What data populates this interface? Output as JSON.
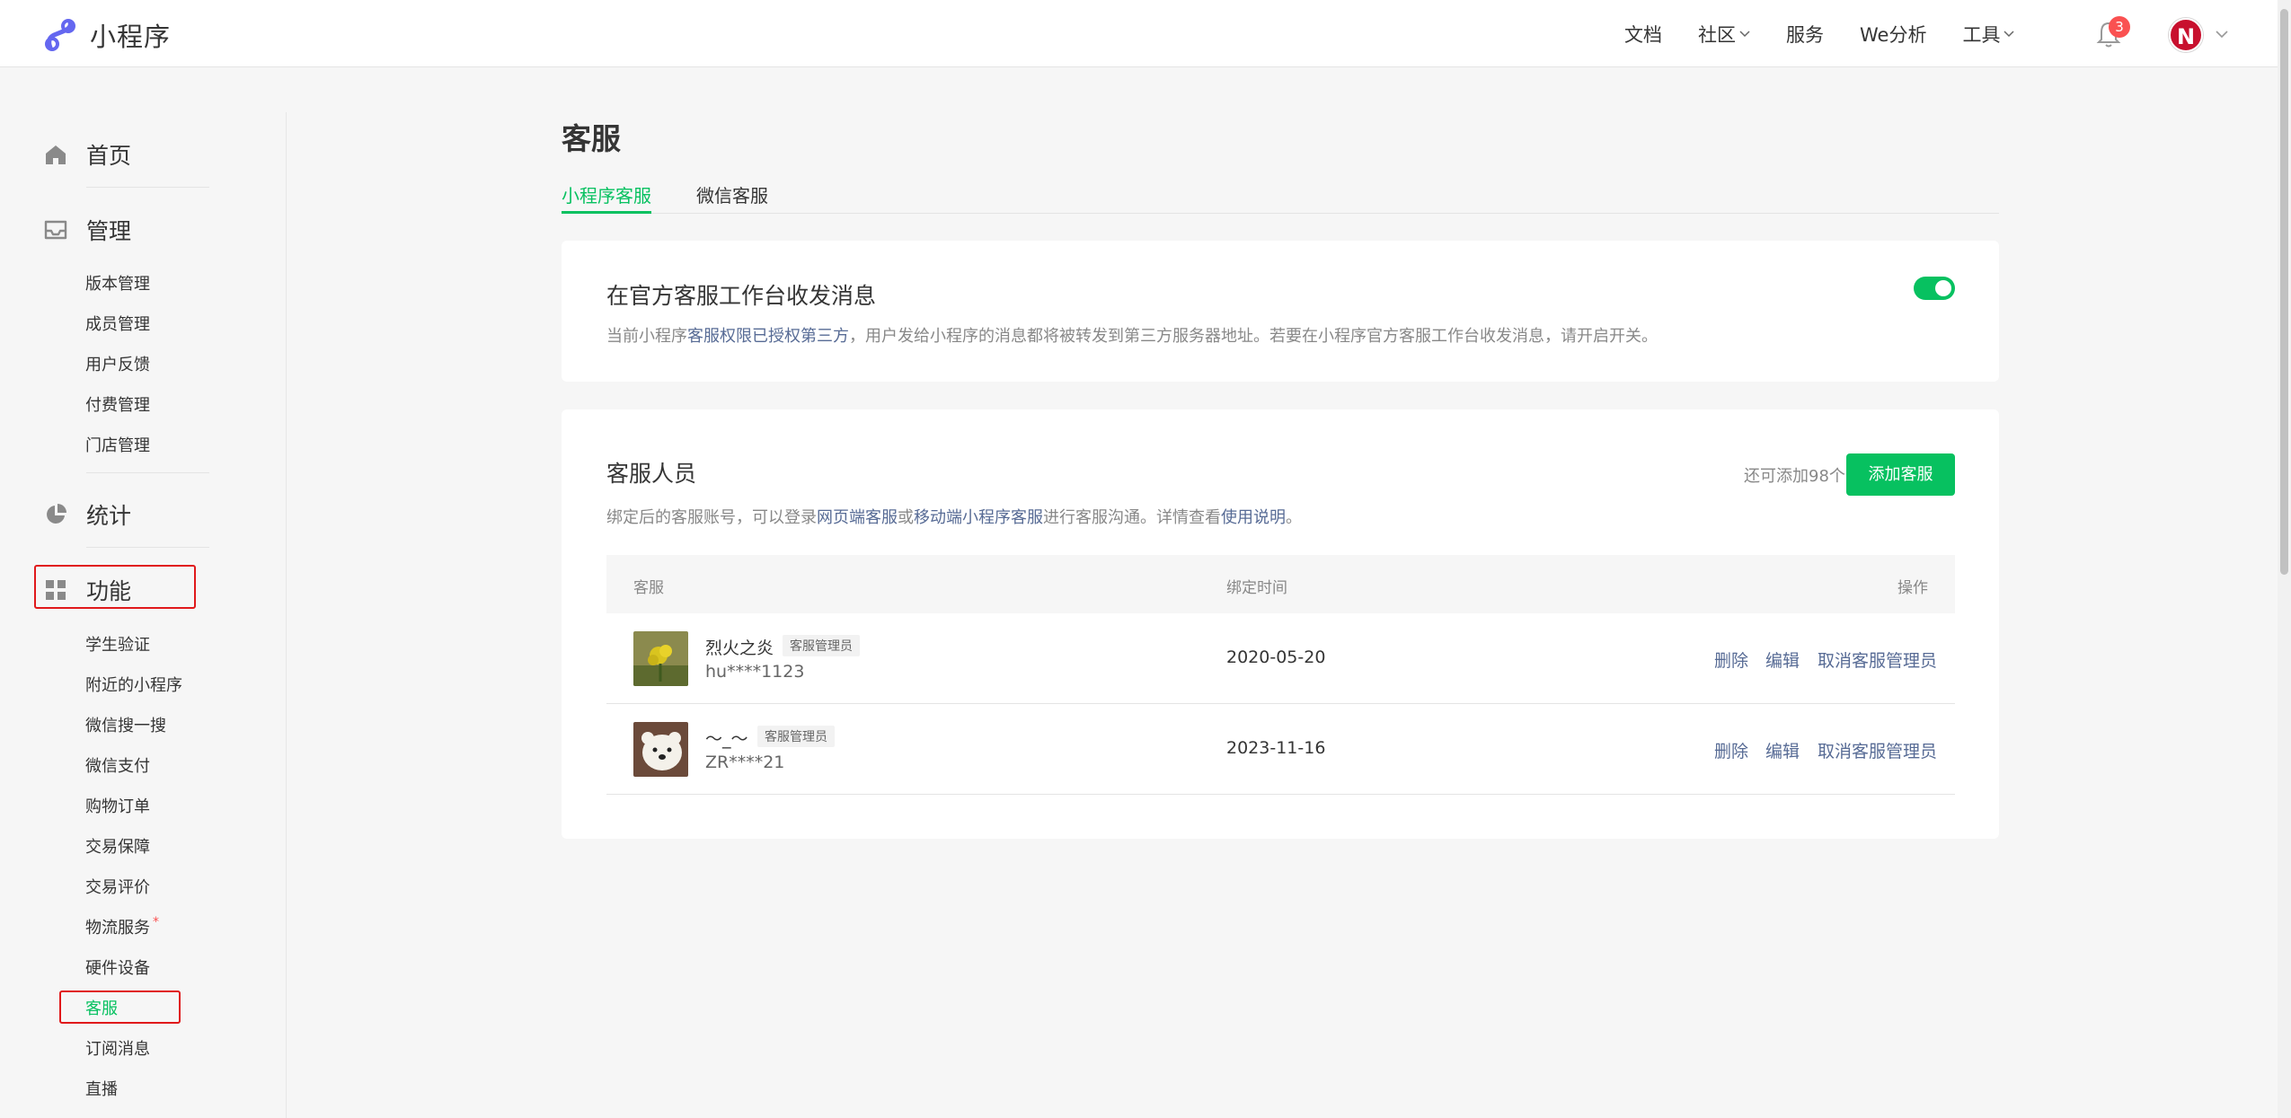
{
  "header": {
    "brand": "小程序",
    "nav": [
      {
        "label": "文档",
        "dropdown": false
      },
      {
        "label": "社区",
        "dropdown": true
      },
      {
        "label": "服务",
        "dropdown": false
      },
      {
        "label": "We分析",
        "dropdown": false
      },
      {
        "label": "工具",
        "dropdown": true
      }
    ],
    "notification_count": "3",
    "avatar_letter": "N"
  },
  "sidebar": {
    "groups": [
      {
        "label": "首页",
        "icon": "home-icon"
      },
      {
        "label": "管理",
        "icon": "inbox-icon",
        "items": [
          "版本管理",
          "成员管理",
          "用户反馈",
          "付费管理",
          "门店管理"
        ]
      },
      {
        "label": "统计",
        "icon": "pie-chart-icon"
      },
      {
        "label": "功能",
        "icon": "grid-icon",
        "items": [
          "学生验证",
          "附近的小程序",
          "微信搜一搜",
          "微信支付",
          "购物订单",
          "交易保障",
          "交易评价",
          "物流服务",
          "硬件设备",
          "客服",
          "订阅消息",
          "直播"
        ]
      }
    ],
    "active_item": "客服"
  },
  "main": {
    "title": "客服",
    "tabs": [
      {
        "label": "小程序客服",
        "active": true
      },
      {
        "label": "微信客服",
        "active": false
      }
    ],
    "message_card": {
      "title": "在官方客服工作台收发消息",
      "desc_prefix": "当前小程序",
      "desc_link": "客服权限已授权第三方",
      "desc_suffix": "，用户发给小程序的消息都将被转发到第三方服务器地址。若要在小程序官方客服工作台收发消息，请开启开关。",
      "toggle_on": true
    },
    "staff_card": {
      "title": "客服人员",
      "desc_part1": "绑定后的客服账号，可以登录",
      "desc_link1": "网页端客服",
      "desc_part2": "或",
      "desc_link2": "移动端小程序客服",
      "desc_part3": "进行客服沟通。详情查看",
      "desc_link3": "使用说明",
      "desc_part4": "。",
      "remaining": "还可添加98个",
      "add_button": "添加客服",
      "columns": [
        "客服",
        "绑定时间",
        "操作"
      ],
      "rows": [
        {
          "name": "烈火之炎",
          "tag": "客服管理员",
          "account": "hu****1123",
          "date": "2020-05-20",
          "actions": [
            "删除",
            "编辑",
            "取消客服管理员"
          ]
        },
        {
          "name": "～_～",
          "tag": "客服管理员",
          "account": "ZR****21",
          "date": "2023-11-16",
          "actions": [
            "删除",
            "编辑",
            "取消客服管理员"
          ]
        }
      ]
    }
  },
  "colors": {
    "accent": "#07c160",
    "link": "#576b95",
    "highlight_border": "#e0191b",
    "badge": "#fa5151"
  }
}
